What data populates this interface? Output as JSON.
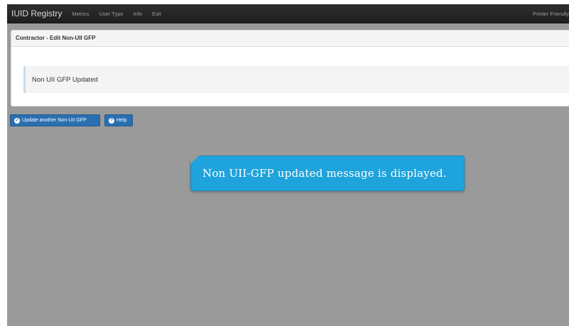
{
  "navbar": {
    "brand": "IUID Registry",
    "items": [
      "Metrics",
      "User Type",
      "Info",
      "Exit"
    ],
    "right_label": "Printer Friendly"
  },
  "panel": {
    "title": "Contractor - Edit Non-UII GFP",
    "alert_message": "Non UII GFP Updated"
  },
  "actions": {
    "update_label": "Update another Non-UII GFP",
    "help_label": "Help"
  },
  "callout": {
    "text": "Non UII-GFP updated message is displayed."
  },
  "colors": {
    "navbar": "#262626",
    "primary_button": "#2a6fb0",
    "callout": "#1fa3dc",
    "overlay": "#9a9a9a"
  }
}
